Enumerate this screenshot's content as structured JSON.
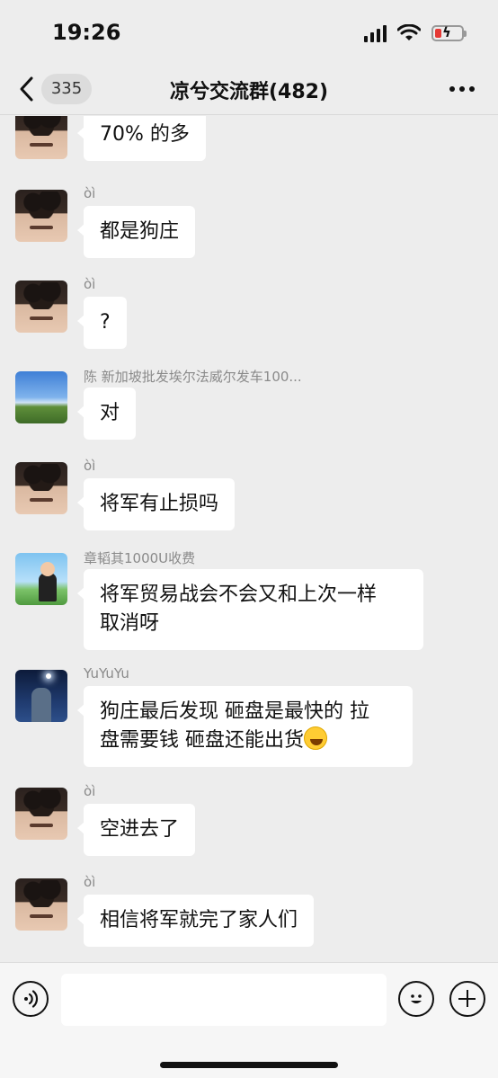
{
  "status_bar": {
    "time": "19:26",
    "battery_level_percent": 20,
    "icons": [
      "signal-icon",
      "wifi-icon",
      "battery-charging-icon"
    ]
  },
  "nav": {
    "back_icon": "chevron-left-icon",
    "unread_count": "335",
    "title": "凉兮交流群(482)",
    "more_icon": "more-dots-icon"
  },
  "messages": [
    {
      "sender": "",
      "avatar": "person",
      "text": "70% 的多"
    },
    {
      "sender": "òì",
      "avatar": "person",
      "text": "都是狗庄"
    },
    {
      "sender": "òì",
      "avatar": "person",
      "text": "?"
    },
    {
      "sender": "陈 新加坡批发埃尔法威尔发车100...",
      "avatar": "landscape",
      "text": "对"
    },
    {
      "sender": "òì",
      "avatar": "person",
      "text": "将军有止损吗"
    },
    {
      "sender": "章韬其1000U收费",
      "avatar": "cartoon",
      "text_lines": [
        "将军贸易战会不会又和上次一样",
        "取消呀"
      ]
    },
    {
      "sender": "YuYuYu",
      "avatar": "night",
      "text_lines": [
        "狗庄最后发现 砸盘是最快的 拉",
        "盘需要钱 砸盘还能出货"
      ],
      "emoji": "grinning-sweat-emoji"
    },
    {
      "sender": "òì",
      "avatar": "person",
      "text": "空进去了"
    },
    {
      "sender": "òì",
      "avatar": "person",
      "text": "相信将军就完了家人们"
    }
  ],
  "input_bar": {
    "voice_icon": "voice-icon",
    "placeholder": "",
    "emoji_icon": "emoji-icon",
    "plus_icon": "plus-icon"
  },
  "colors": {
    "background": "#ededed",
    "bubble": "#ffffff",
    "battery_low": "#e53935"
  }
}
